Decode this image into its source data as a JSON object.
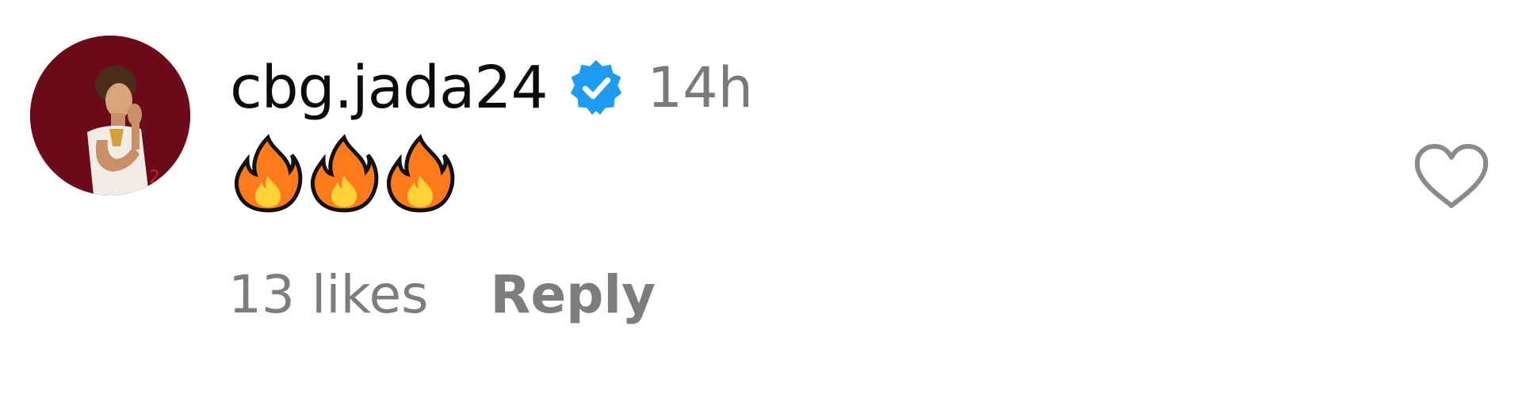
{
  "comment": {
    "username": "cbg.jada24",
    "verified": true,
    "timestamp": "14h",
    "body_emojis": [
      "fire",
      "fire",
      "fire"
    ],
    "likes": "13 likes",
    "reply_label": "Reply"
  },
  "colors": {
    "avatar_background": "#6b0a19",
    "verified_badge": "#1d9bf0",
    "secondary_text": "#7a7a7a"
  }
}
